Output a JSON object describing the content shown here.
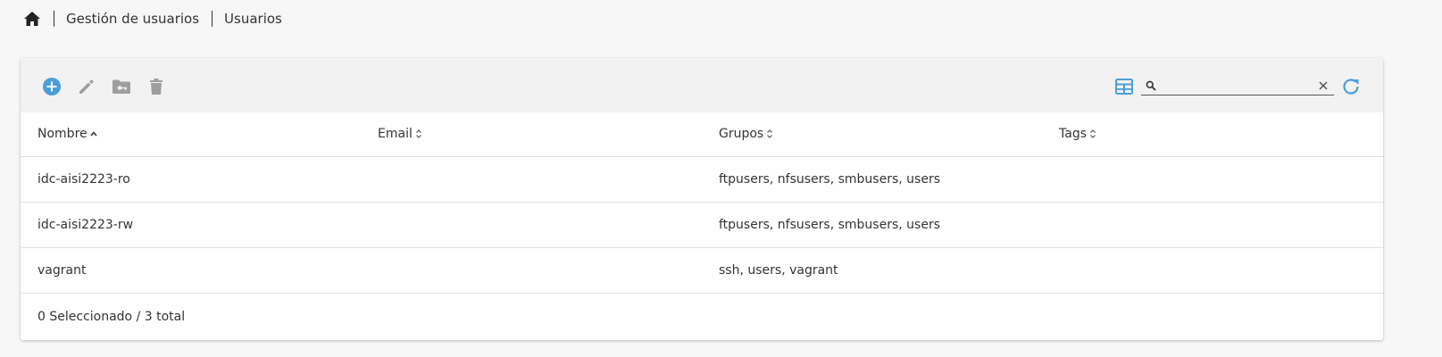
{
  "breadcrumb": {
    "home_icon": "home-icon",
    "items": [
      "Gestión de usuarios",
      "Usuarios"
    ]
  },
  "toolbar": {
    "add_icon": "add-circle-icon",
    "edit_icon": "pencil-icon",
    "key_folder_icon": "folder-key-icon",
    "delete_icon": "trash-icon",
    "columns_icon": "table-columns-icon",
    "search": {
      "value": "",
      "placeholder": ""
    },
    "refresh_icon": "refresh-icon",
    "accent_color": "#4a9fd8",
    "disabled_color": "#9e9e9e"
  },
  "table": {
    "columns": [
      "Nombre",
      "Email",
      "Grupos",
      "Tags"
    ],
    "sorted_column": "Nombre",
    "rows": [
      {
        "nombre": "idc-aisi2223-ro",
        "email": "",
        "grupos": "ftpusers, nfsusers, smbusers, users",
        "tags": ""
      },
      {
        "nombre": "idc-aisi2223-rw",
        "email": "",
        "grupos": "ftpusers, nfsusers, smbusers, users",
        "tags": ""
      },
      {
        "nombre": "vagrant",
        "email": "",
        "grupos": "ssh, users, vagrant",
        "tags": ""
      }
    ]
  },
  "footer": {
    "selection_text": "0 Seleccionado / 3 total"
  }
}
